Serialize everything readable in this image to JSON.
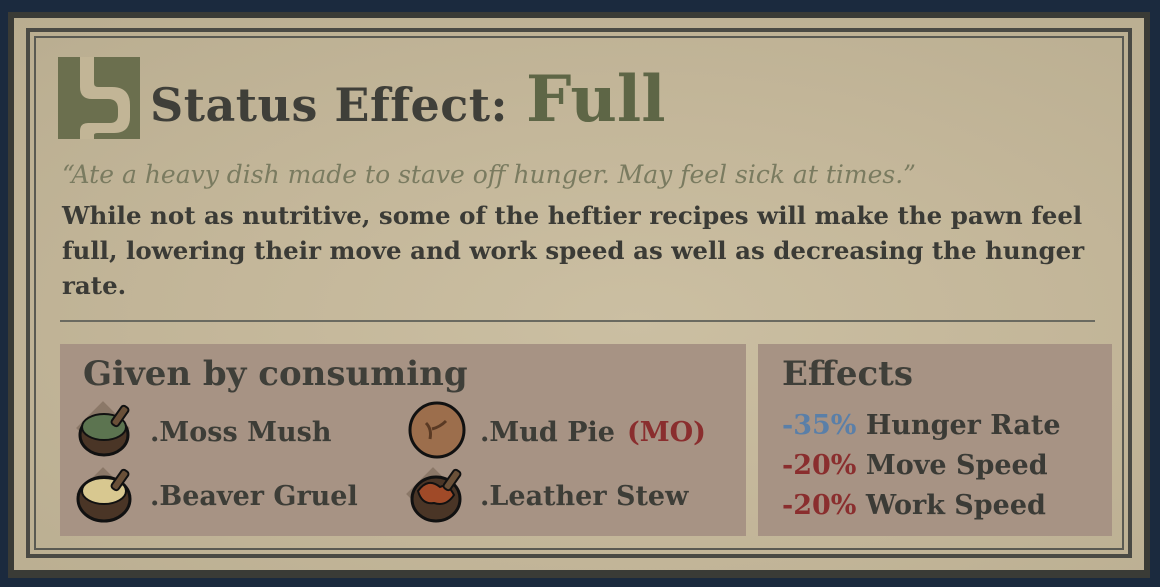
{
  "title": {
    "prefix": "Status Effect:",
    "name": "Full",
    "icon": "stomach-icon"
  },
  "quote": "“Ate a heavy dish made to stave off hunger. May feel sick at times.”",
  "description": "While not as nutritive, some of the heftier recipes will make the pawn feel full, lowering their move and work speed as well as decreasing the hunger rate.",
  "given_by": {
    "heading": "Given by consuming",
    "items": [
      {
        "label": ".Moss Mush",
        "icon": "moss-mush-pot-icon",
        "tag": ""
      },
      {
        "label": ".Mud Pie",
        "icon": "mud-pie-icon",
        "tag": "(MO)"
      },
      {
        "label": ".Beaver Gruel",
        "icon": "beaver-gruel-pot-icon",
        "tag": ""
      },
      {
        "label": ".Leather Stew",
        "icon": "leather-stew-pot-icon",
        "tag": ""
      }
    ]
  },
  "effects": {
    "heading": "Effects",
    "list": [
      {
        "value": "-35%",
        "label": "Hunger Rate",
        "color": "#5a7fa8"
      },
      {
        "value": "-20%",
        "label": "Move Speed",
        "color": "#8a2e2e"
      },
      {
        "value": "-20%",
        "label": "Work Speed",
        "color": "#8a2e2e"
      }
    ]
  },
  "colors": {
    "accent_green": "#5e6646",
    "positive_blue": "#5a7fa8",
    "negative_red": "#8a2e2e"
  }
}
